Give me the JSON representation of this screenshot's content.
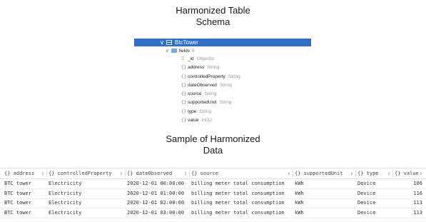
{
  "titles": {
    "schema_line1": "Harmonized Table",
    "schema_line2": "Schema",
    "data_line1": "Sample of Harmonized",
    "data_line2": "Data"
  },
  "schema": {
    "root": {
      "name": "BtcTower",
      "expanded": true
    },
    "fields_group": {
      "name": "fields",
      "count": "8"
    },
    "fields": [
      {
        "name": "_id",
        "type": "ObjectId",
        "icon": "key-icon"
      },
      {
        "name": "address",
        "type": "String",
        "icon": "braces-icon"
      },
      {
        "name": "controlledProperty",
        "type": "String",
        "icon": "braces-icon"
      },
      {
        "name": "dateObserved",
        "type": "String",
        "icon": "braces-icon"
      },
      {
        "name": "source",
        "type": "String",
        "icon": "braces-icon"
      },
      {
        "name": "supportedUnit",
        "type": "String",
        "icon": "braces-icon"
      },
      {
        "name": "type",
        "type": "String",
        "icon": "braces-icon"
      },
      {
        "name": "value",
        "type": "Int32",
        "icon": "braces-icon"
      }
    ]
  },
  "table": {
    "columns": [
      "{} address",
      "{} controlledProperty",
      "{} dateObserved",
      "{} source",
      "{} supportedUnit",
      "{} type",
      "{} value"
    ],
    "rows": [
      [
        "BTC tower",
        "Electricity",
        "2020-12-01 00:00:00",
        "billing meter total consumption",
        "kWh",
        "Device",
        "106"
      ],
      [
        "BTC tower",
        "Electricity",
        "2020-12-01 01:00:00",
        "billing meter total consumption",
        "kWh",
        "Device",
        "116"
      ],
      [
        "BTC tower",
        "Electricity",
        "2020-12-01 02:00:00",
        "billing meter total consumption",
        "kWh",
        "Device",
        "113"
      ],
      [
        "BTC tower",
        "Electricity",
        "2020-12-01 03:00:00",
        "billing meter total consumption",
        "kWh",
        "Device",
        "113"
      ]
    ]
  },
  "colors": {
    "selection": "#2f6fc7",
    "key_icon": "#d59b1e",
    "type_text": "#9a9a9a"
  }
}
